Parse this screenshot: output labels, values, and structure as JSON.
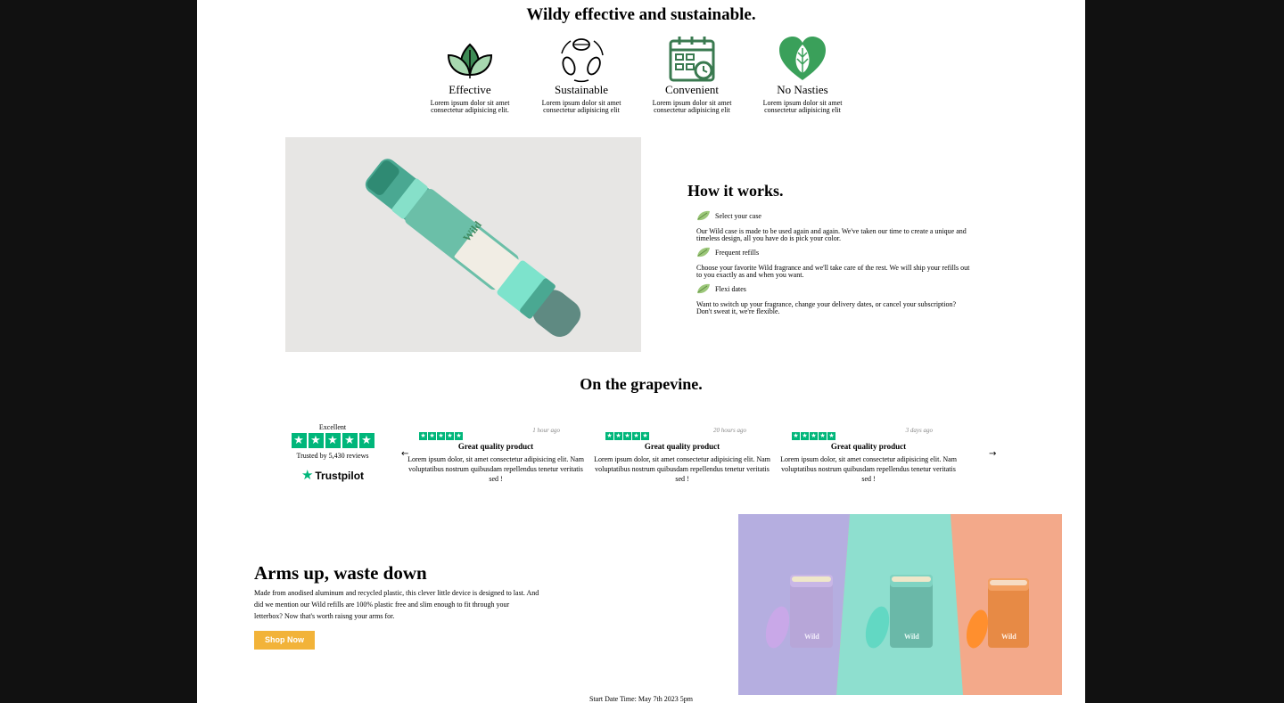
{
  "features": {
    "title": "Wildy effective and sustainable.",
    "items": [
      {
        "icon": "leaves-icon",
        "name": "Effective",
        "desc": "Lorem ipsum dolor sit amet consectetur adipisicing elit."
      },
      {
        "icon": "recycle-leaves-icon",
        "name": "Sustainable",
        "desc": "Lorem ipsum dolor sit amet consectetur adipisicing elit"
      },
      {
        "icon": "calendar-icon",
        "name": "Convenient",
        "desc": "Lorem ipsum dolor sit amet consectetur adipisicing elit"
      },
      {
        "icon": "heart-leaf-icon",
        "name": "No Nasties",
        "desc": "Lorem ipsum dolor sit amet consectetur adipisicing elit"
      }
    ]
  },
  "how": {
    "title": "How it works.",
    "image_brand": "Wild",
    "steps": [
      {
        "label": "Select your case",
        "text": "Our Wild case is made to be used again and again. We've taken our time to create a unique and timeless design, all you have do is pick your color."
      },
      {
        "label": "Frequent refills",
        "text": "Choose your favorite Wild fragrance and we'll take care of the rest. We will ship your refills out to you exactly as and when you want."
      },
      {
        "label": "Flexi dates",
        "text": "Want to switch up your fragrance, change your delivery dates, or cancel your subscription? Don't sweat it, we're flexible."
      }
    ]
  },
  "reviews": {
    "title": "On the grapevine.",
    "trustpilot": {
      "rating": "Excellent",
      "trusted": "Trusted by 5,430 reviews",
      "logo": "Trustpilot"
    },
    "prev_arrow": "←",
    "next_arrow": "→",
    "items": [
      {
        "time": "1 hour ago",
        "title": "Great quality product",
        "body": "Lorem ipsum dolor, sit amet consectetur adipisicing elit. Nam voluptatibus nostrum quibusdam repellendus tenetur veritatis sed !"
      },
      {
        "time": "20 hours ago",
        "title": "Great quality product",
        "body": "Lorem ipsum dolor, sit amet consectetur adipisicing elit. Nam voluptatibus nostrum quibusdam repellendus tenetur veritatis sed !"
      },
      {
        "time": "3 days ago",
        "title": "Great quality product",
        "body": "Lorem ipsum dolor, sit amet consectetur adipisicing elit. Nam voluptatibus nostrum quibusdam repellendus tenetur veritatis sed !"
      }
    ]
  },
  "arms": {
    "title": "Arms up, waste down",
    "text": "Made from anodised aluminum and recycled plastic, this clever little device is designed to last. And did we mention our Wild refills are 100% plastic free and slim enough to fit through your letterbox? Now that's worth raisng your arms for.",
    "button": "Shop Now",
    "product_brand": "Wild"
  },
  "footer": {
    "start_date": "Start Date Time: May 7th 2023 5pm"
  },
  "colors": {
    "accent": "#00b67a",
    "button": "#f2b339",
    "leaf": "#2f6b44",
    "icon_green": "#3aa05a"
  }
}
